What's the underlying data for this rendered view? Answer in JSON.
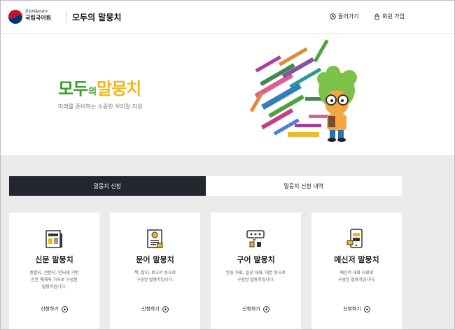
{
  "header": {
    "org_sub": "문화체육관광부",
    "org_name": "국립국어원",
    "site_title": "모두의 말뭉치",
    "login_label": "들어가기",
    "signup_label": "회원 가입"
  },
  "hero": {
    "title_part1": "모두",
    "title_part2": "의",
    "title_part3": "말뭉치",
    "subtitle": "미래를 준비하는 소중한 우리말 자원"
  },
  "tabs": [
    {
      "label": "말뭉치 신청",
      "active": true
    },
    {
      "label": "말뭉치 신청 내역",
      "active": false
    }
  ],
  "cards": [
    {
      "title": "신문 말뭉치",
      "desc_line1": "종합지, 전문지, 인터넷 기반",
      "desc_line2": "신문 매체의 기사로 구성된",
      "desc_line3": "말뭉치입니다.",
      "action": "신청하기",
      "icon": "newspaper-icon"
    },
    {
      "title": "문어 말뭉치",
      "desc_line1": "책, 잡지, 보고서 등으로",
      "desc_line2": "구성된 말뭉치입니다.",
      "desc_line3": "",
      "action": "신청하기",
      "icon": "document-icon"
    },
    {
      "title": "구어 말뭉치",
      "desc_line1": "방송 자료, 일상 대화, 대본 등으로",
      "desc_line2": "구성된 말뭉치입니다.",
      "desc_line3": "",
      "action": "신청하기",
      "icon": "speech-icon"
    },
    {
      "title": "메신저 말뭉치",
      "desc_line1": "메신저 대화 자료로",
      "desc_line2": "구성된 말뭉치입니다.",
      "desc_line3": "",
      "action": "신청하기",
      "icon": "messenger-icon"
    }
  ],
  "colors": {
    "accent_green": "#3a9b2b",
    "accent_yellow": "#f0b81a",
    "tab_active_bg": "#23262d",
    "body_bg": "#ebebeb"
  }
}
